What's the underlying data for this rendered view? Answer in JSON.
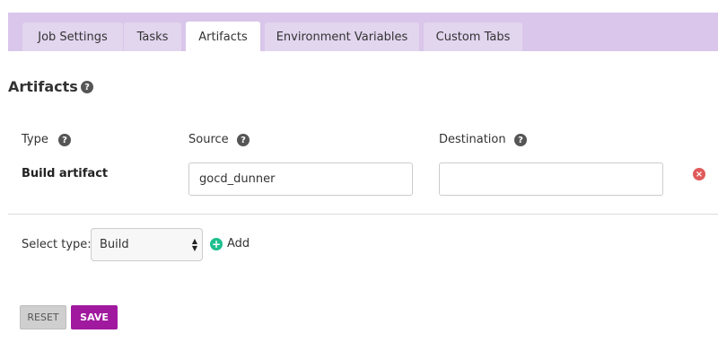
{
  "tabs": [
    {
      "label": "Job Settings",
      "active": false
    },
    {
      "label": "Tasks",
      "active": false
    },
    {
      "label": "Artifacts",
      "active": true
    },
    {
      "label": "Environment Variables",
      "active": false
    },
    {
      "label": "Custom Tabs",
      "active": false
    }
  ],
  "section": {
    "title": "Artifacts",
    "help_icon": "?"
  },
  "columns": {
    "type": "Type",
    "source": "Source",
    "destination": "Destination"
  },
  "artifact_row": {
    "type_label": "Build artifact",
    "source_value": "gocd_dunner",
    "destination_value": "",
    "remove_icon": "×"
  },
  "add_section": {
    "select_label": "Select type:",
    "selected_type": "Build",
    "add_icon": "+",
    "add_label": "Add"
  },
  "buttons": {
    "reset": "RESET",
    "save": "SAVE"
  },
  "colors": {
    "tab_bar": "#d9c6ea",
    "save": "#a0199f",
    "add": "#1dbf8e",
    "remove": "#e05a5a"
  }
}
